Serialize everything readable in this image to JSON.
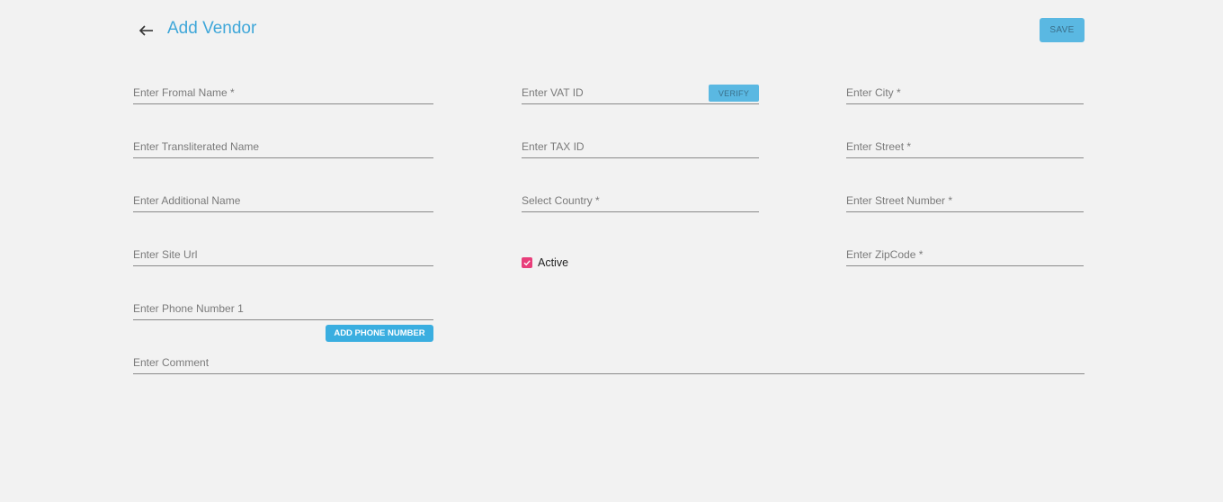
{
  "header": {
    "back_icon": "arrow-left-icon",
    "title": "Add Vendor",
    "save_label": "SAVE",
    "accent_color": "#3fa7d9"
  },
  "form": {
    "formal_name": {
      "value": "",
      "placeholder": "Enter Fromal Name *"
    },
    "transliterated_name": {
      "value": "",
      "placeholder": "Enter Transliterated Name"
    },
    "additional_name": {
      "value": "",
      "placeholder": "Enter Additional Name"
    },
    "site_url": {
      "value": "",
      "placeholder": "Enter Site Url"
    },
    "phone_1": {
      "value": "",
      "placeholder": "Enter Phone Number 1"
    },
    "add_phone_label": "ADD PHONE NUMBER",
    "vat_id": {
      "value": "",
      "placeholder": "Enter VAT ID"
    },
    "verify_label": "VERIFY",
    "tax_id": {
      "value": "",
      "placeholder": "Enter TAX ID"
    },
    "country": {
      "value": "",
      "placeholder": "Select Country *"
    },
    "active": {
      "label": "Active",
      "checked": true,
      "check_color": "#e83e7a"
    },
    "city": {
      "value": "",
      "placeholder": "Enter City *"
    },
    "street": {
      "value": "",
      "placeholder": "Enter Street *"
    },
    "street_number": {
      "value": "",
      "placeholder": "Enter Street Number *"
    },
    "zipcode": {
      "value": "",
      "placeholder": "Enter ZipCode *"
    },
    "comment": {
      "value": "",
      "placeholder": "Enter Comment"
    }
  }
}
